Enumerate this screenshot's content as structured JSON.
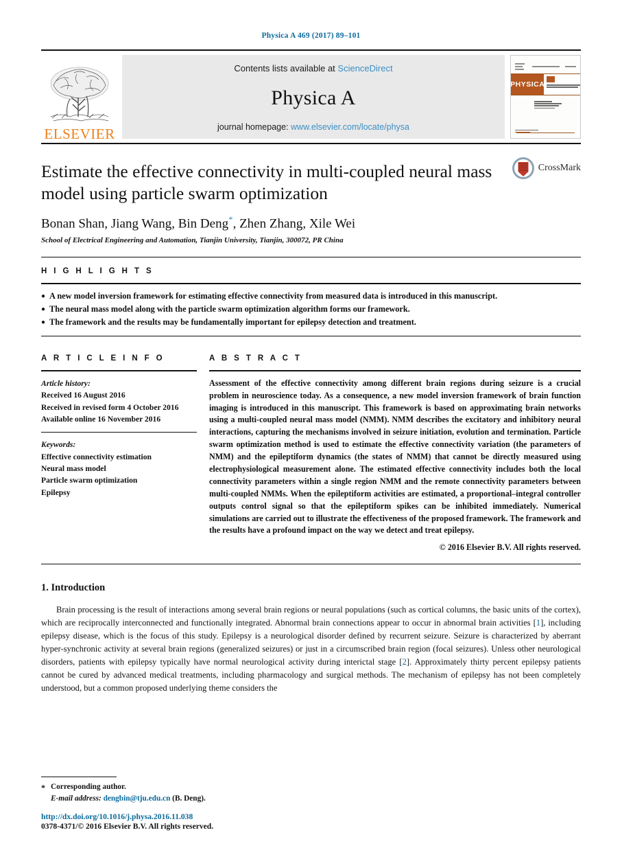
{
  "running_head": "Physica A 469 (2017) 89–101",
  "masthead": {
    "contents_prefix": "Contents lists available at ",
    "sciencedirect": "ScienceDirect",
    "journal_name": "Physica A",
    "homepage_prefix": "journal homepage: ",
    "homepage_url": "www.elsevier.com/locate/physa",
    "publisher": "ELSEVIER",
    "cover_title": "PHYSICA",
    "link_color": "#3b8fc4",
    "publisher_color": "#ef7f1a"
  },
  "article": {
    "title": "Estimate the effective connectivity in multi-coupled neural mass model using particle swarm optimization",
    "authors": "Bonan Shan, Jiang Wang, Bin Deng",
    "authors_tail": ", Zhen Zhang, Xile Wei",
    "corresponding_marker": "*",
    "affiliation": "School of Electrical Engineering and Automation, Tianjin University, Tianjin, 300072, PR China",
    "crossmark_label": "CrossMark"
  },
  "highlights": {
    "label": "H I G H L I G H T S",
    "items": [
      "A new model inversion framework for estimating effective connectivity from measured data is introduced in this manuscript.",
      "The neural mass model along with the particle swarm optimization algorithm forms our framework.",
      "The framework and the results may be fundamentally important for epilepsy detection and treatment."
    ]
  },
  "article_info": {
    "label": "A R T I C L E   I N F O",
    "history_title": "Article history:",
    "history": [
      "Received 16 August 2016",
      "Received in revised form 4 October 2016",
      "Available online 16 November 2016"
    ],
    "keywords_title": "Keywords:",
    "keywords": [
      "Effective connectivity estimation",
      "Neural mass model",
      "Particle swarm optimization",
      "Epilepsy"
    ]
  },
  "abstract": {
    "label": "A B S T R A C T",
    "text": "Assessment of the effective connectivity among different brain regions during seizure is a crucial problem in neuroscience today. As a consequence, a new model inversion framework of brain function imaging is introduced in this manuscript. This framework is based on approximating brain networks using a multi-coupled neural mass model (NMM). NMM describes the excitatory and inhibitory neural interactions, capturing the mechanisms involved in seizure initiation, evolution and termination. Particle swarm optimization method is used to estimate the effective connectivity variation (the parameters of NMM) and the epileptiform dynamics (the states of NMM) that cannot be directly measured using electrophysiological measurement alone. The estimated effective connectivity includes both the local connectivity parameters within a single region NMM and the remote connectivity parameters between multi-coupled NMMs. When the epileptiform activities are estimated, a proportional–integral controller outputs control signal so that the epileptiform spikes can be inhibited immediately. Numerical simulations are carried out to illustrate the effectiveness of the proposed framework. The framework and the results have a profound impact on the way we detect and treat epilepsy.",
    "copyright": "© 2016 Elsevier B.V. All rights reserved."
  },
  "introduction": {
    "heading": "1. Introduction",
    "para_part1": "Brain processing is the result of interactions among several brain regions or neural populations (such as cortical columns, the basic units of the cortex), which are reciprocally interconnected and functionally integrated. Abnormal brain connections appear to occur in abnormal brain activities [",
    "cite1": "1",
    "para_part2": "], including epilepsy disease, which is the focus of this study. Epilepsy is a neurological disorder defined by recurrent seizure. Seizure is characterized by aberrant hyper-synchronic activity at several brain regions (generalized seizures) or just in a circumscribed brain region (focal seizures). Unless other neurological disorders, patients with epilepsy typically have normal neurological activity during interictal stage [",
    "cite2": "2",
    "para_part3": "]. Approximately thirty percent epilepsy patients cannot be cured by advanced medical treatments, including pharmacology and surgical methods. The mechanism of epilepsy has not been completely understood, but a common proposed underlying theme considers the"
  },
  "footnote": {
    "star": "*",
    "corresponding": "Corresponding author.",
    "email_label": "E-mail address:",
    "email": "dengbin@tju.edu.cn",
    "email_suffix": " (B. Deng).",
    "doi": "http://dx.doi.org/10.1016/j.physa.2016.11.038",
    "issn": "0378-4371/© 2016 Elsevier B.V. All rights reserved."
  }
}
